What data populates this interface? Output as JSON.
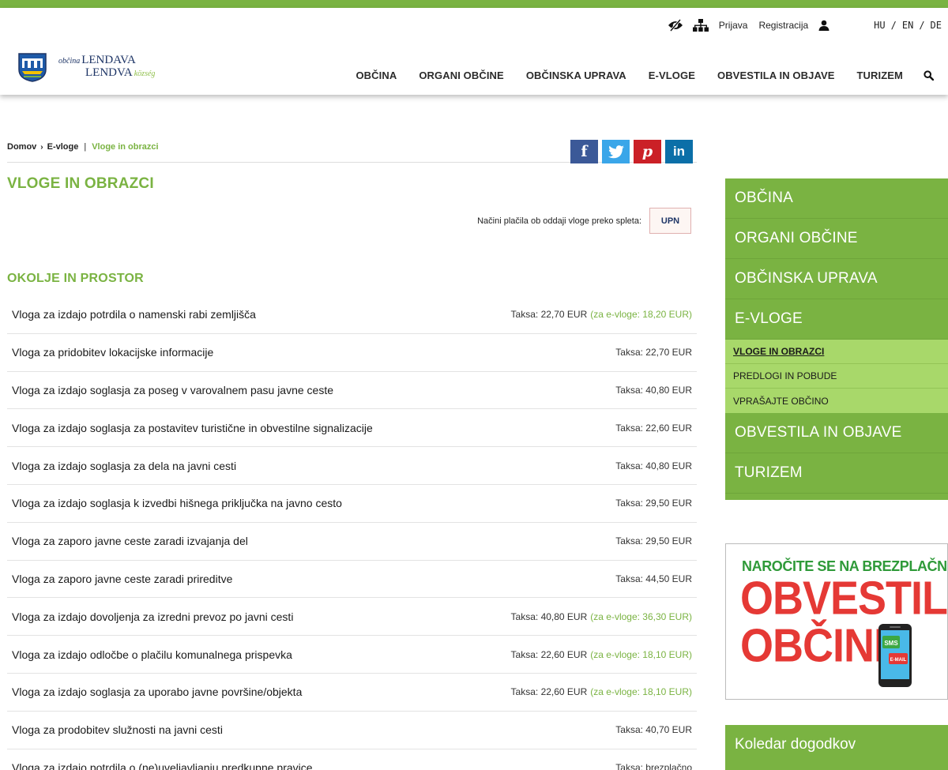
{
  "colors": {
    "accent": "#7ab342",
    "accent_light": "#a8d86a",
    "logo_blue": "#1e3566"
  },
  "utility": {
    "login": "Prijava",
    "register": "Registracija",
    "languages": [
      "HU",
      "EN",
      "DE"
    ],
    "lang_separator": "/"
  },
  "logo": {
    "line1_small": "občina",
    "line1": "LENDAVA",
    "line2": "LENDVA",
    "line2_small": "község"
  },
  "nav": [
    "OBČINA",
    "ORGANI OBČINE",
    "OBČINSKA UPRAVA",
    "E-VLOGE",
    "OBVESTILA IN OBJAVE",
    "TURIZEM"
  ],
  "breadcrumb": {
    "home": "Domov",
    "arrow": "›",
    "parent": "E-vloge",
    "separator": "|",
    "current": "Vloge in obrazci"
  },
  "social": {
    "facebook": "f",
    "pinterest": "p",
    "linkedin": "in"
  },
  "page_title": "VLOGE IN OBRAZCI",
  "payment": {
    "label": "Načini plačila ob oddaji vloge preko spleta:",
    "upn": "UPN"
  },
  "section_title": "OKOLJE IN PROSTOR",
  "forms": [
    {
      "name": "Vloga za izdajo potrdila o namenski rabi zemljišča",
      "fee": "Taksa: 22,70 EUR",
      "online": "(za e-vloge: 18,20 EUR)"
    },
    {
      "name": "Vloga za pridobitev lokacijske informacije",
      "fee": "Taksa: 22,70 EUR",
      "online": ""
    },
    {
      "name": "Vloga za izdajo soglasja za poseg v varovalnem pasu javne ceste",
      "fee": "Taksa: 40,80 EUR",
      "online": ""
    },
    {
      "name": "Vloga za izdajo soglasja za postavitev turistične in obvestilne signalizacije",
      "fee": "Taksa: 22,60 EUR",
      "online": ""
    },
    {
      "name": "Vloga za izdajo soglasja za dela na javni cesti",
      "fee": "Taksa: 40,80 EUR",
      "online": ""
    },
    {
      "name": "Vloga za izdajo soglasja k izvedbi hišnega priključka na javno cesto",
      "fee": "Taksa: 29,50 EUR",
      "online": ""
    },
    {
      "name": "Vloga za zaporo javne ceste zaradi izvajanja del",
      "fee": "Taksa: 29,50 EUR",
      "online": ""
    },
    {
      "name": "Vloga za zaporo javne ceste zaradi prireditve",
      "fee": "Taksa: 44,50 EUR",
      "online": ""
    },
    {
      "name": "Vloga za izdajo dovoljenja za izredni prevoz po javni cesti",
      "fee": "Taksa: 40,80 EUR",
      "online": "(za e-vloge: 36,30 EUR)"
    },
    {
      "name": "Vloga za izdajo odločbe o plačilu komunalnega prispevka",
      "fee": "Taksa: 22,60 EUR",
      "online": "(za e-vloge: 18,10 EUR)"
    },
    {
      "name": "Vloga za izdajo soglasja za uporabo javne površine/objekta",
      "fee": "Taksa: 22,60 EUR",
      "online": "(za e-vloge: 18,10 EUR)"
    },
    {
      "name": "Vloga za prodobitev služnosti na javni cesti",
      "fee": "Taksa: 40,70 EUR",
      "online": ""
    },
    {
      "name": "Vloga za izdajo potrdila o (ne)uveljavljanju predkupne pravice",
      "fee": "Taksa: brezplačno",
      "online": ""
    }
  ],
  "sidebar": {
    "top": [
      "OBČINA",
      "ORGANI OBČINE",
      "OBČINSKA UPRAVA",
      "E-VLOGE"
    ],
    "sub": [
      "VLOGE IN OBRAZCI",
      "PREDLOGI IN POBUDE",
      "VPRAŠAJTE OBČINO"
    ],
    "bottom": [
      "OBVESTILA IN OBJAVE",
      "TURIZEM"
    ]
  },
  "banner": {
    "line1": "NAROČITE SE NA BREZPLAČNA",
    "line2": "OBVESTILA",
    "line3": "OBČINE",
    "sms": "SMS",
    "email": "E-MAIL"
  },
  "calendar": "Koledar dogodkov"
}
